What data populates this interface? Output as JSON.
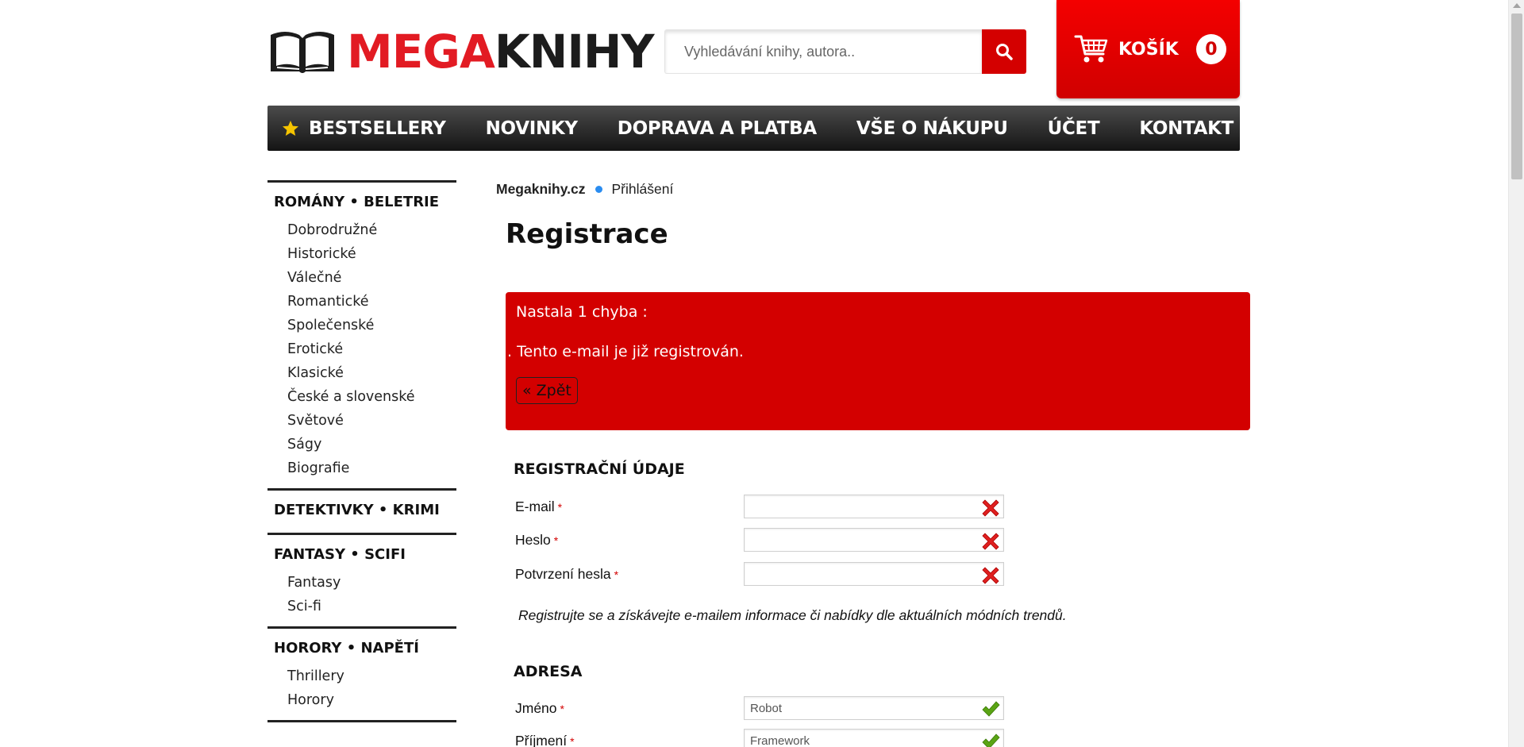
{
  "header": {
    "logo_part1": "MEGA",
    "logo_part2": "KNIHY",
    "search_placeholder": "Vyhledávání knihy, autora..",
    "cart_label": "KOŠÍK",
    "cart_count": "0"
  },
  "nav": {
    "items": [
      {
        "label": "BESTSELLERY",
        "icon": "star-icon"
      },
      {
        "label": "NOVINKY"
      },
      {
        "label": "DOPRAVA A PLATBA"
      },
      {
        "label": "VŠE O NÁKUPU"
      },
      {
        "label": "ÚČET"
      },
      {
        "label": "KONTAKT"
      }
    ]
  },
  "sidebar": {
    "categories": [
      {
        "title": "ROMÁNY • BELETRIE",
        "items": [
          "Dobrodružné",
          "Historické",
          "Válečné",
          "Romantické",
          "Společenské",
          "Erotické",
          "Klasické",
          "České a slovenské",
          "Světové",
          "Ságy",
          "Biografie"
        ]
      },
      {
        "title": "DETEKTIVKY • KRIMI",
        "items": []
      },
      {
        "title": "FANTASY • SCIFI",
        "items": [
          "Fantasy",
          "Sci-fi"
        ]
      },
      {
        "title": "HORORY • NAPĚTÍ",
        "items": [
          "Thrillery",
          "Horory"
        ]
      }
    ]
  },
  "breadcrumb": {
    "home": "Megaknihy.cz",
    "current": "Přihlášení"
  },
  "page": {
    "title": "Registrace"
  },
  "error": {
    "heading": "Nastala 1 chyba :",
    "message": ". Tento e-mail je již registrován.",
    "back_label": "« Zpět"
  },
  "registration": {
    "section_title": "REGISTRAČNÍ ÚDAJE",
    "fields": [
      {
        "label": "E-mail",
        "required": "*",
        "value": "",
        "status": "invalid"
      },
      {
        "label": "Heslo",
        "required": "*",
        "value": "",
        "status": "invalid"
      },
      {
        "label": "Potvrzení hesla",
        "required": "*",
        "value": "",
        "status": "invalid"
      }
    ],
    "note": "Registrujte se a získávejte e-mailem informace či nabídky dle aktuálních módních trendů."
  },
  "address": {
    "section_title": "ADRESA",
    "fields": [
      {
        "label": "Jméno",
        "required": "*",
        "value": "Robot",
        "status": "valid"
      },
      {
        "label": "Příjmení",
        "required": "*",
        "value": "Framework",
        "status": "valid"
      }
    ]
  },
  "colors": {
    "brand_red": "#d30000",
    "nav_dark": "#141414",
    "breadcrumb_dot": "#2a8cf0",
    "valid_green": "#5aa414",
    "invalid_red": "#e02020"
  }
}
